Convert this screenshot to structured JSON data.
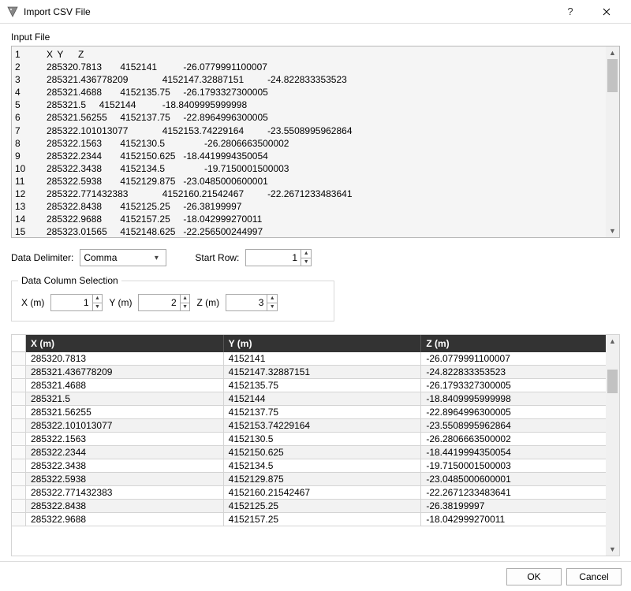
{
  "window": {
    "title": "Import CSV File"
  },
  "labels": {
    "input_file": "Input File",
    "delimiter": "Data Delimiter:",
    "start_row": "Start Row:",
    "column_selection": "Data Column Selection",
    "x_col": "X (m)",
    "y_col": "Y (m)",
    "z_col": "Z (m)"
  },
  "delimiter": {
    "value": "Comma"
  },
  "start_row_value": "1",
  "col_indices": {
    "x": "1",
    "y": "2",
    "z": "3"
  },
  "preview_header": "X\tY\tZ",
  "raw_rows": [
    {
      "n": "1",
      "text": "X\tY\tZ"
    },
    {
      "n": "2",
      "text": "285320.7813\t4152141\t\t-26.0779991100007"
    },
    {
      "n": "3",
      "text": "285321.436778209\t\t4152147.32887151\t\t-24.822833353523"
    },
    {
      "n": "4",
      "text": "285321.4688\t4152135.75\t-26.1793327300005"
    },
    {
      "n": "5",
      "text": "285321.5\t4152144\t\t-18.8409995999998"
    },
    {
      "n": "6",
      "text": "285321.56255\t4152137.75\t-22.8964996300005"
    },
    {
      "n": "7",
      "text": "285322.101013077\t\t4152153.74229164\t\t-23.5508995962864"
    },
    {
      "n": "8",
      "text": "285322.1563\t4152130.5\t\t-26.2806663500002"
    },
    {
      "n": "9",
      "text": "285322.2344\t4152150.625\t-18.4419994350054"
    },
    {
      "n": "10",
      "text": "285322.3438\t4152134.5\t\t-19.7150001500003"
    },
    {
      "n": "11",
      "text": "285322.5938\t4152129.875\t-23.0485000600001"
    },
    {
      "n": "12",
      "text": "285322.771432383\t\t4152160.21542467\t\t-22.2671233483641"
    },
    {
      "n": "13",
      "text": "285322.8438\t4152125.25\t-26.38199997"
    },
    {
      "n": "14",
      "text": "285322.9688\t4152157.25\t-18.042999270011"
    },
    {
      "n": "15",
      "text": "285323.01565\t4152148.625\t-22.256500244997"
    }
  ],
  "table": {
    "headers": {
      "x": "X (m)",
      "y": "Y (m)",
      "z": "Z (m)"
    },
    "rows": [
      {
        "x": "285320.7813",
        "y": "4152141",
        "z": "-26.0779991100007"
      },
      {
        "x": "285321.436778209",
        "y": "4152147.32887151",
        "z": "-24.822833353523"
      },
      {
        "x": "285321.4688",
        "y": "4152135.75",
        "z": "-26.1793327300005"
      },
      {
        "x": "285321.5",
        "y": "4152144",
        "z": "-18.8409995999998"
      },
      {
        "x": "285321.56255",
        "y": "4152137.75",
        "z": "-22.8964996300005"
      },
      {
        "x": "285322.101013077",
        "y": "4152153.74229164",
        "z": "-23.5508995962864"
      },
      {
        "x": "285322.1563",
        "y": "4152130.5",
        "z": "-26.2806663500002"
      },
      {
        "x": "285322.2344",
        "y": "4152150.625",
        "z": "-18.4419994350054"
      },
      {
        "x": "285322.3438",
        "y": "4152134.5",
        "z": "-19.7150001500003"
      },
      {
        "x": "285322.5938",
        "y": "4152129.875",
        "z": "-23.0485000600001"
      },
      {
        "x": "285322.771432383",
        "y": "4152160.21542467",
        "z": "-22.2671233483641"
      },
      {
        "x": "285322.8438",
        "y": "4152125.25",
        "z": "-26.38199997"
      },
      {
        "x": "285322.9688",
        "y": "4152157.25",
        "z": "-18.042999270011"
      }
    ]
  },
  "buttons": {
    "ok": "OK",
    "cancel": "Cancel"
  }
}
